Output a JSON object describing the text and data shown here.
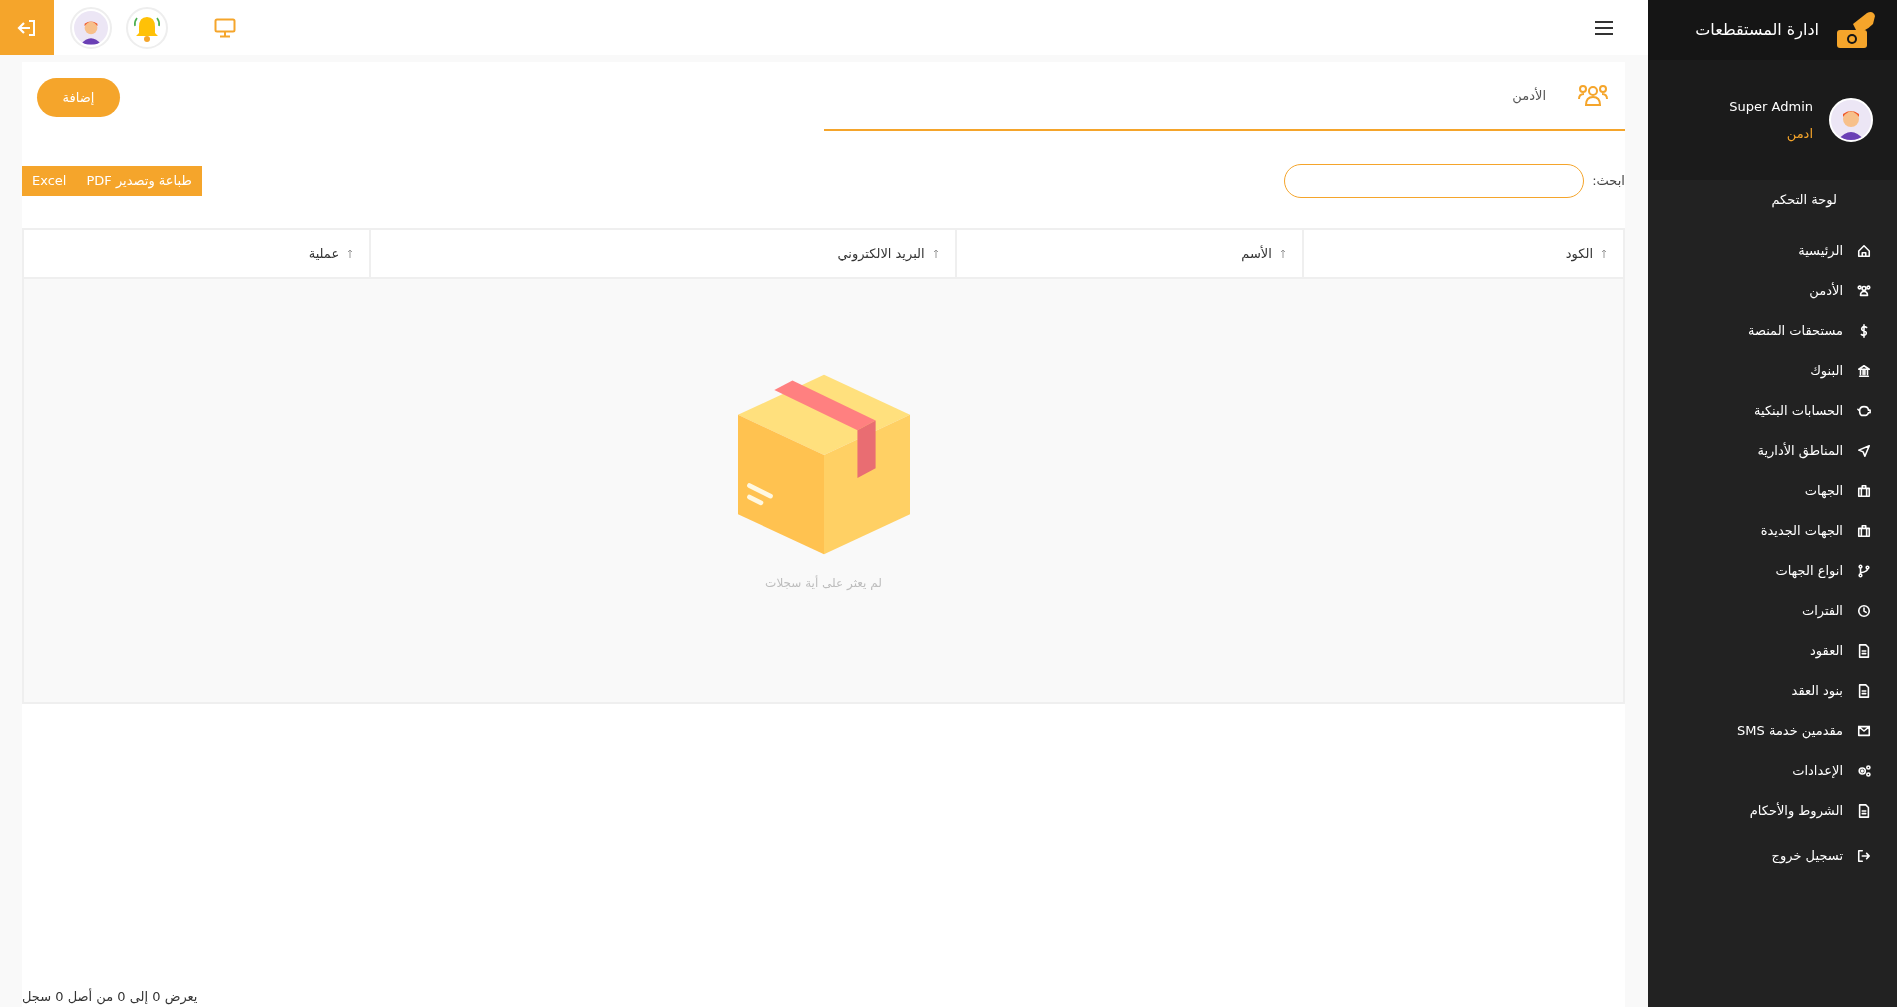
{
  "sidebar": {
    "brand": "ادارة المستقطعات",
    "user": {
      "name": "Super Admin",
      "role": "ادمن"
    },
    "section": "لوحة التحكم",
    "items": [
      {
        "label": "الرئيسية"
      },
      {
        "label": "الأدمن"
      },
      {
        "label": "مستحقات المنصة"
      },
      {
        "label": "البنوك"
      },
      {
        "label": "الحسابات البنكية"
      },
      {
        "label": "المناطق الأدارية"
      },
      {
        "label": "الجهات"
      },
      {
        "label": "الجهات الجديدة"
      },
      {
        "label": "انواع الجهات"
      },
      {
        "label": "الفترات"
      },
      {
        "label": "العقود"
      },
      {
        "label": "بنود العقد"
      },
      {
        "label": "مقدمين خدمة SMS"
      },
      {
        "label": "الإعدادات"
      },
      {
        "label": "الشروط والأحكام"
      },
      {
        "label": "تسجيل خروج"
      }
    ]
  },
  "page": {
    "title": "الأدمن",
    "add_button": "إضافة",
    "search": {
      "label": "ابحث:"
    },
    "export_buttons": [
      "طباعة وتصدير PDF",
      "Excel"
    ],
    "table": {
      "columns": [
        "الكود",
        "الأسم",
        "البريد الالكتروني",
        "عملية"
      ],
      "empty_message": "لم يعثر على أية سجلات"
    },
    "footer": "يعرض 0 إلى 0 من أصل 0 سجل"
  }
}
